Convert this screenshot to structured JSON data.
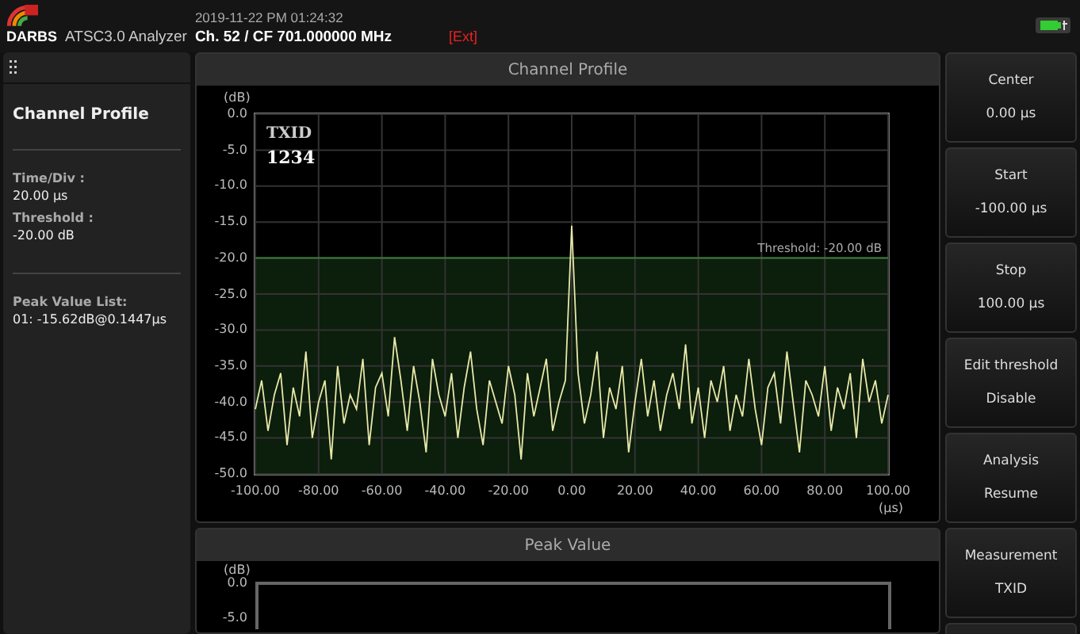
{
  "header": {
    "brand": "DARBS",
    "app_title": "ATSC3.0 Analyzer",
    "timestamp": "2019-11-22 PM 01:24:32",
    "channel": "Ch. 52 / CF 701.000000 MHz",
    "source": "[Ext]"
  },
  "sidebar": {
    "title": "Channel Profile",
    "groups": [
      {
        "items": [
          {
            "label": "Time/Div :",
            "value": "20.00 μs"
          },
          {
            "label": "Threshold :",
            "value": "-20.00 dB"
          }
        ]
      },
      {
        "items": [
          {
            "label": "Peak Value List:",
            "value": "01: -15.62dB@0.1447μs"
          }
        ]
      }
    ]
  },
  "channel_profile": {
    "title": "Channel Profile",
    "overlay_label": "TXID",
    "overlay_value": "1234",
    "chart_data": {
      "type": "line",
      "xlabel": "(μs)",
      "ylabel": "(dB)",
      "xlim": [
        -100,
        100
      ],
      "ylim": [
        -50,
        0
      ],
      "xticks": [
        {
          "value": -100,
          "label": "-100.00"
        },
        {
          "value": -80,
          "label": "-80.00"
        },
        {
          "value": -60,
          "label": "-60.00"
        },
        {
          "value": -40,
          "label": "-40.00"
        },
        {
          "value": -20,
          "label": "-20.00"
        },
        {
          "value": 0,
          "label": "0.00"
        },
        {
          "value": 20,
          "label": "20.00"
        },
        {
          "value": 40,
          "label": "40.00"
        },
        {
          "value": 60,
          "label": "60.00"
        },
        {
          "value": 80,
          "label": "80.00"
        },
        {
          "value": 100,
          "label": "100.00"
        }
      ],
      "yticks": [
        {
          "value": 0,
          "label": "0.0"
        },
        {
          "value": -5,
          "label": "-5.0"
        },
        {
          "value": -10,
          "label": "-10.0"
        },
        {
          "value": -15,
          "label": "-15.0"
        },
        {
          "value": -20,
          "label": "-20.0"
        },
        {
          "value": -25,
          "label": "-25.0"
        },
        {
          "value": -30,
          "label": "-30.0"
        },
        {
          "value": -35,
          "label": "-35.0"
        },
        {
          "value": -40,
          "label": "-40.0"
        },
        {
          "value": -45,
          "label": "-45.0"
        },
        {
          "value": -50,
          "label": "-50.0"
        }
      ],
      "x": [
        -100,
        -98,
        -96,
        -94,
        -92,
        -90,
        -88,
        -86,
        -84,
        -82,
        -80,
        -78,
        -76,
        -74,
        -72,
        -70,
        -68,
        -66,
        -64,
        -62,
        -60,
        -58,
        -56,
        -54,
        -52,
        -50,
        -48,
        -46,
        -44,
        -42,
        -40,
        -38,
        -36,
        -34,
        -32,
        -30,
        -28,
        -26,
        -24,
        -22,
        -20,
        -18,
        -16,
        -14,
        -12,
        -10,
        -8,
        -6,
        -4,
        -2,
        0,
        2,
        4,
        6,
        8,
        10,
        12,
        14,
        16,
        18,
        20,
        22,
        24,
        26,
        28,
        30,
        32,
        34,
        36,
        38,
        40,
        42,
        44,
        46,
        48,
        50,
        52,
        54,
        56,
        58,
        60,
        62,
        64,
        66,
        68,
        70,
        72,
        74,
        76,
        78,
        80,
        82,
        84,
        86,
        88,
        90,
        92,
        94,
        96,
        98,
        100
      ],
      "grid": true,
      "series": [
        {
          "color": "#e8e8a8",
          "values": [
            -41,
            -37,
            -44,
            -39,
            -36,
            -46,
            -38,
            -42,
            -33,
            -45,
            -40,
            -37,
            -48,
            -35,
            -43,
            -39,
            -41,
            -34,
            -46,
            -38,
            -36,
            -42,
            -31,
            -37,
            -44,
            -35,
            -40,
            -47,
            -34,
            -39,
            -42,
            -36,
            -45,
            -38,
            -33,
            -41,
            -46,
            -37,
            -40,
            -43,
            -35,
            -39,
            -48,
            -36,
            -42,
            -38,
            -34,
            -44,
            -40,
            -37,
            -15.5,
            -36,
            -43,
            -39,
            -33,
            -45,
            -38,
            -41,
            -35,
            -47,
            -40,
            -34,
            -42,
            -37,
            -44,
            -39,
            -36,
            -41,
            -32,
            -43,
            -38,
            -45,
            -37,
            -40,
            -35,
            -44,
            -39,
            -42,
            -34,
            -41,
            -46,
            -38,
            -36,
            -43,
            -33,
            -40,
            -47,
            -37,
            -39,
            -42,
            -35,
            -44,
            -38,
            -41,
            -36,
            -45,
            -34,
            -40,
            -37,
            -43,
            -39
          ]
        }
      ],
      "ref_lines": [
        {
          "axis": "y",
          "value": -20,
          "color": "#3c7a3c"
        }
      ],
      "bands": [
        {
          "axis": "y",
          "from": -50,
          "to": -20,
          "color": "#0c1e0c"
        }
      ],
      "annotations": [
        "Threshold: -20.00 dB"
      ]
    }
  },
  "peak_value": {
    "title": "Peak Value",
    "y_unit": "(dB)",
    "yticks": [
      "0.0",
      "-5.0"
    ]
  },
  "buttons": [
    {
      "label": "Center",
      "value": "0.00 μs"
    },
    {
      "label": "Start",
      "value": "-100.00 μs"
    },
    {
      "label": "Stop",
      "value": "100.00 μs"
    },
    {
      "label": "Edit threshold",
      "value": "Disable"
    },
    {
      "label": "Analysis",
      "value": "Resume"
    },
    {
      "label": "Measurement",
      "value": "TXID"
    }
  ]
}
